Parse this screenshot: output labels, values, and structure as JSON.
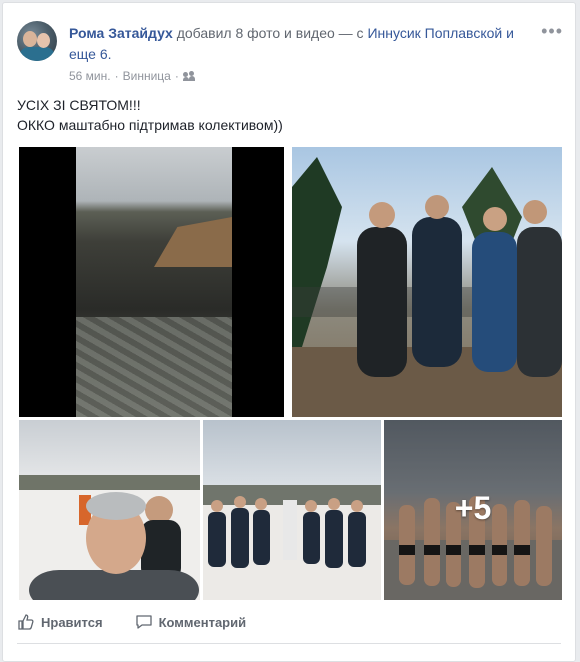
{
  "post": {
    "author": "Рома Затайдух",
    "action_text": "добавил 8 фото и видео — с",
    "tagged": "Иннусик Поплавской",
    "and_others": "и еще 6.",
    "time": "56 мин.",
    "separator": "·",
    "location": "Винница",
    "separator2": "·",
    "audience_icon": "friends-icon",
    "menu_glyph": "•••",
    "text_line1": "УСІХ ЗІ СВЯТОМ!!!",
    "text_line2": "ОККО маштабно підтримав колективом))",
    "more_photos_label": "+5"
  },
  "actions": {
    "like_label": "Нравится",
    "like_icon": "thumbs-up-icon",
    "comment_label": "Комментарий",
    "comment_icon": "comment-bubble-icon"
  },
  "colors": {
    "link": "#365899",
    "meta": "#90949c",
    "text": "#1d2129"
  }
}
